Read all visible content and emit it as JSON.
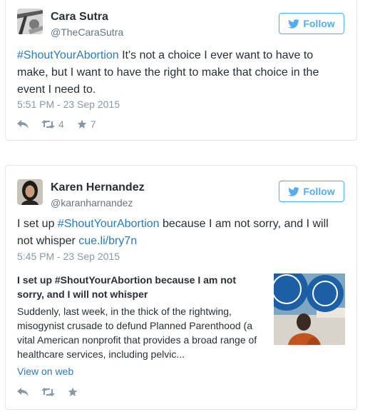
{
  "tweets": [
    {
      "name": "Cara Sutra",
      "handle": "@TheCaraSutra",
      "follow_label": "Follow",
      "text_hashtag": "#ShoutYourAbortion",
      "text_body": " It's not a choice I ever want to have to make, but I want to have the right to make that choice in the event I need to.",
      "timestamp": "5:51 PM - 23 Sep 2015",
      "retweets": "4",
      "likes": "7"
    },
    {
      "name": "Karen Hernandez",
      "handle": "@karanharnandez",
      "follow_label": "Follow",
      "text_pre": "I set up ",
      "text_hashtag": "#ShoutYourAbortion",
      "text_mid": " because I am not sorry, and I will not whisper ",
      "text_link": "cue.li/bry7n",
      "timestamp": "5:45 PM - 23 Sep 2015",
      "card": {
        "title": "I set up #ShoutYourAbortion because I am not sorry, and I will not whisper",
        "description": "Suddenly, last week, in the thick of the rightwing, misogynist crusade to defund Planned Parenthood (a vital American nonprofit that provides a broad range of healthcare services, including pelvic..."
      },
      "view_on_web": "View on web"
    }
  ],
  "colors": {
    "link": "#2b7bb9",
    "follow": "#55acee",
    "meta": "#8899a6",
    "border": "#e1e8ed"
  }
}
